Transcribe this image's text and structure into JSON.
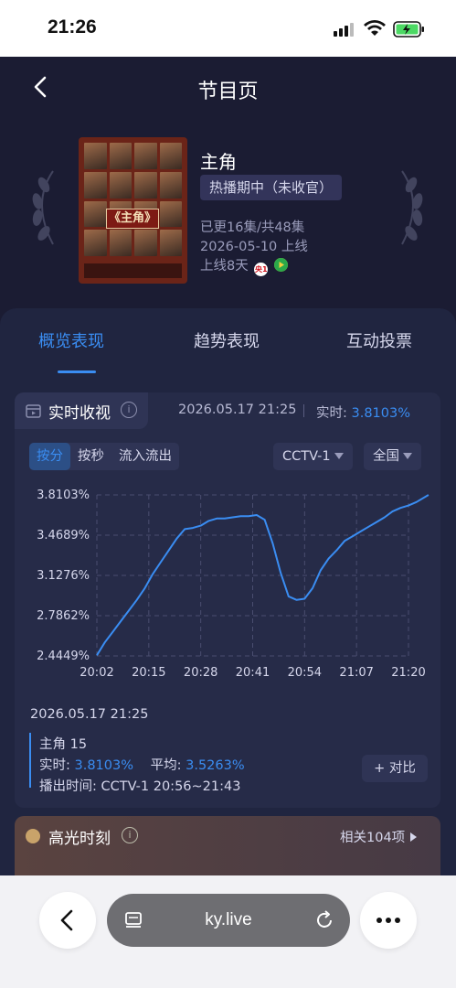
{
  "status_bar": {
    "time": "21:26"
  },
  "header": {
    "title": "节目页"
  },
  "program": {
    "name": "主角",
    "status": "热播期中（未收官）",
    "episodes": "已更16集/共48集",
    "premiere": "2026-05-10 上线",
    "days_online": "上线8天",
    "platform_badge": "央1",
    "poster_title": "《主角》"
  },
  "tabs": [
    {
      "label": "概览表现",
      "active": true
    },
    {
      "label": "趋势表现",
      "active": false
    },
    {
      "label": "互动投票",
      "active": false
    }
  ],
  "realtime": {
    "section_title": "实时收视",
    "info_glyph": "i",
    "timestamp": "2026.05.17 21:25",
    "rt_label": "实时:",
    "rt_value": "3.8103%",
    "modes": [
      "按分",
      "按秒",
      "流入流出"
    ],
    "active_mode": "按分",
    "channel": "CCTV-1",
    "region": "全国"
  },
  "chart_data": {
    "type": "line",
    "x_ticks": [
      "20:02",
      "20:15",
      "20:28",
      "20:41",
      "20:54",
      "21:07",
      "21:20"
    ],
    "y_ticks": [
      "3.8103%",
      "3.4689%",
      "3.1276%",
      "2.7862%",
      "2.4449%"
    ],
    "ylim": [
      2.4449,
      3.8103
    ],
    "grid": "dashed",
    "series": [
      {
        "color": "#3a8df2",
        "points": [
          [
            "20:02",
            2.45
          ],
          [
            "20:04",
            2.56
          ],
          [
            "20:06",
            2.65
          ],
          [
            "20:08",
            2.74
          ],
          [
            "20:10",
            2.83
          ],
          [
            "20:12",
            2.92
          ],
          [
            "20:14",
            3.02
          ],
          [
            "20:16",
            3.14
          ],
          [
            "20:18",
            3.24
          ],
          [
            "20:20",
            3.34
          ],
          [
            "20:22",
            3.44
          ],
          [
            "20:24",
            3.52
          ],
          [
            "20:26",
            3.53
          ],
          [
            "20:28",
            3.55
          ],
          [
            "20:30",
            3.59
          ],
          [
            "20:32",
            3.61
          ],
          [
            "20:34",
            3.61
          ],
          [
            "20:36",
            3.62
          ],
          [
            "20:38",
            3.63
          ],
          [
            "20:40",
            3.63
          ],
          [
            "20:42",
            3.64
          ],
          [
            "20:44",
            3.6
          ],
          [
            "20:46",
            3.4
          ],
          [
            "20:48",
            3.15
          ],
          [
            "20:50",
            2.95
          ],
          [
            "20:52",
            2.92
          ],
          [
            "20:54",
            2.93
          ],
          [
            "20:56",
            3.02
          ],
          [
            "20:58",
            3.17
          ],
          [
            "21:00",
            3.27
          ],
          [
            "21:02",
            3.34
          ],
          [
            "21:04",
            3.42
          ],
          [
            "21:06",
            3.46
          ],
          [
            "21:08",
            3.5
          ],
          [
            "21:10",
            3.54
          ],
          [
            "21:12",
            3.58
          ],
          [
            "21:14",
            3.62
          ],
          [
            "21:16",
            3.67
          ],
          [
            "21:18",
            3.7
          ],
          [
            "21:20",
            3.72
          ],
          [
            "21:22",
            3.75
          ],
          [
            "21:25",
            3.81
          ]
        ]
      }
    ]
  },
  "summary": {
    "timestamp": "2026.05.17 21:25",
    "episode": "主角 15",
    "rt_label": "实时:",
    "rt_value": "3.8103%",
    "avg_label": "平均:",
    "avg_value": "3.5263%",
    "airtime": "播出时间: CCTV-1 20:56~21:43",
    "compare_button": "+ 对比"
  },
  "highlight": {
    "title": "高光时刻",
    "info_glyph": "i",
    "related": "相关104项"
  },
  "browser": {
    "url": "ky.live"
  },
  "colors": {
    "background": "#1b1c33",
    "panel": "#202540",
    "accent": "#3a8df2"
  }
}
